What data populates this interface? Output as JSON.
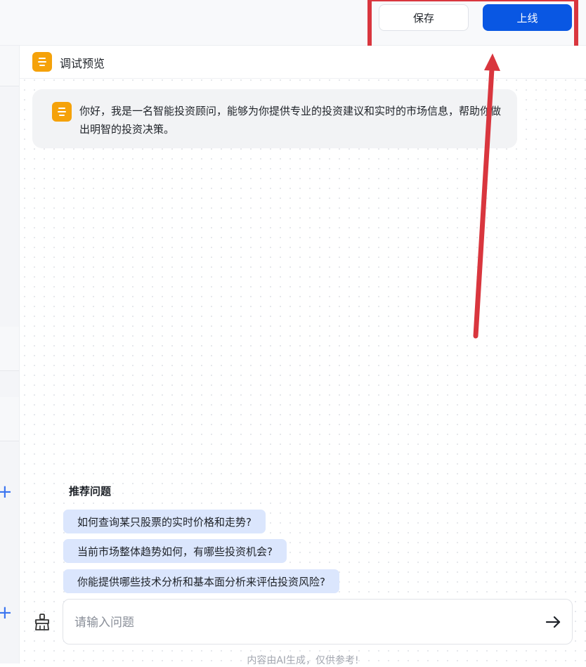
{
  "toolbar": {
    "save_label": "保存",
    "publish_label": "上线",
    "highlight_color": "#d9363e",
    "publish_color": "#0957e3"
  },
  "panel": {
    "title": "调试预览",
    "bot_icon": "bot-avatar-icon",
    "accent_color": "#f5a20a"
  },
  "chat": {
    "greeting": "你好，我是一名智能投资顾问，能够为你提供专业的投资建议和实时的市场信息，帮助你做出明智的投资决策。"
  },
  "suggestions": {
    "title": "推荐问题",
    "items": [
      "如何查询某只股票的实时价格和走势?",
      "当前市场整体趋势如何，有哪些投资机会?",
      "你能提供哪些技术分析和基本面分析来评估投资风险?"
    ]
  },
  "input": {
    "placeholder": "请输入问题",
    "value": "",
    "clear_icon": "broom-icon",
    "send_icon": "arrow-right-icon"
  },
  "footer": {
    "disclaimer": "内容由AI生成，仅供参考!"
  }
}
